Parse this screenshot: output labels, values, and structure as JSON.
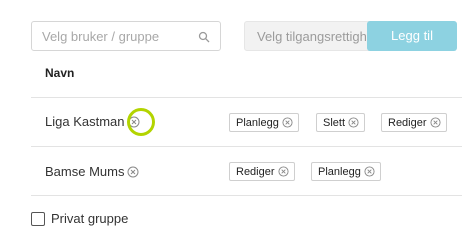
{
  "toolbar": {
    "search_placeholder": "Velg bruker / gruppe",
    "permission_placeholder": "Velg tilgangsrettigheter",
    "add_label": "Legg til"
  },
  "table": {
    "header": "Navn",
    "rows": [
      {
        "name": "Liga Kastman",
        "permissions": [
          "Planlegg",
          "Slett",
          "Rediger"
        ]
      },
      {
        "name": "Bamse Mums",
        "permissions": [
          "Rediger",
          "Planlegg"
        ]
      }
    ]
  },
  "private_group": {
    "label": "Privat gruppe",
    "checked": false
  },
  "colors": {
    "accent": "#8dd2e1",
    "highlight": "#b3d400"
  },
  "icons": {
    "search": "search-icon",
    "remove": "remove-icon"
  }
}
